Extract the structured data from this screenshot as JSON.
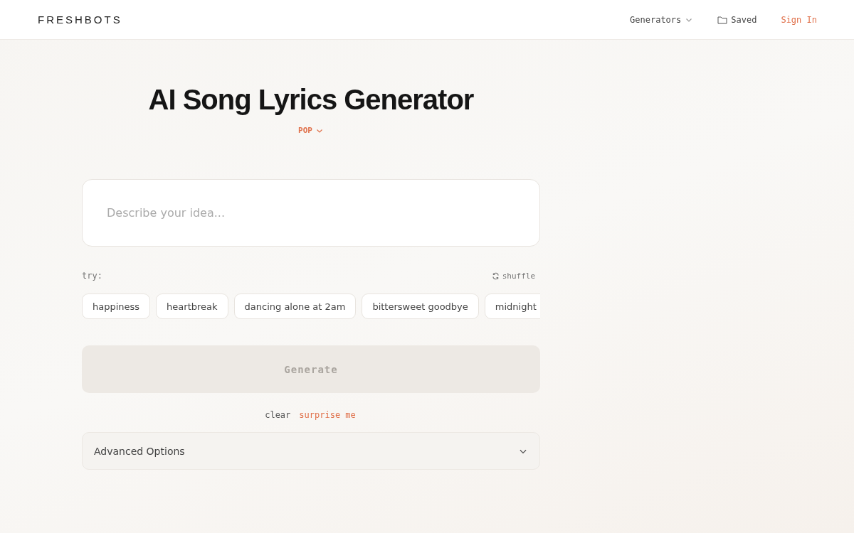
{
  "header": {
    "logo": "FRESHBOTS",
    "nav": [
      {
        "kind": "dropdown",
        "label": "Generators"
      },
      {
        "kind": "folder",
        "label": "Saved"
      },
      {
        "kind": "accent",
        "label": "Sign In"
      }
    ]
  },
  "title": "AI Song Lyrics Generator",
  "genre": {
    "label": "POP"
  },
  "prompt": {
    "placeholder": "Describe your idea..."
  },
  "suggestions": {
    "label": "try:",
    "shuffle": "shuffle",
    "chips": [
      "happiness",
      "heartbreak",
      "dancing alone at 2am",
      "bittersweet goodbye",
      "midnight"
    ]
  },
  "generate": {
    "label": "Generate",
    "disabled": true
  },
  "actions": [
    {
      "kind": "plain",
      "label": "clear"
    },
    {
      "kind": "accent",
      "label": "surprise me"
    }
  ],
  "advanced": {
    "label": "Advanced Options",
    "expanded": false
  }
}
